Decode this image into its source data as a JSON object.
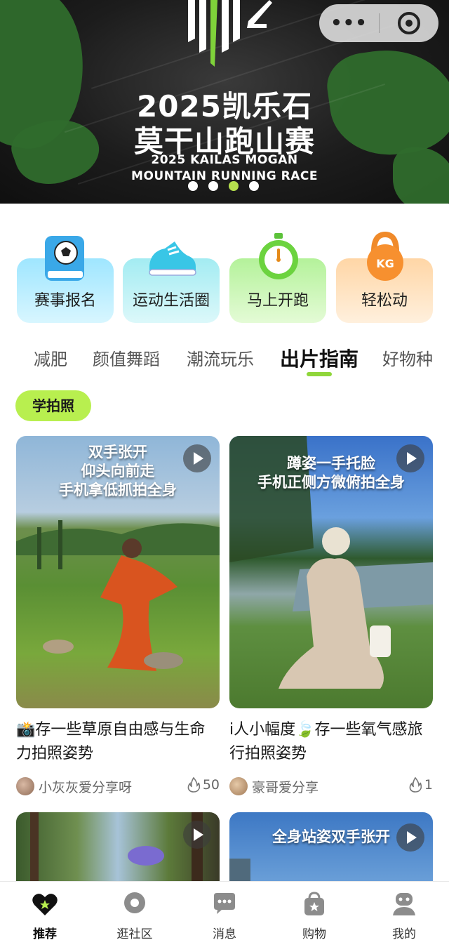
{
  "banner": {
    "title_line1": "2025凯乐石",
    "title_line2": "莫干山跑山赛",
    "subtitle_line1": "2025 KAILAS MOGAN",
    "subtitle_line2": "MOUNTAIN RUNNING RACE",
    "slides": 4,
    "active_slide": 3
  },
  "capsule": {
    "more_label": "•••"
  },
  "quick_tiles": [
    {
      "label": "赛事报名",
      "icon": "soccer-book-icon"
    },
    {
      "label": "运动生活圈",
      "icon": "sneaker-icon"
    },
    {
      "label": "马上开跑",
      "icon": "stopwatch-icon"
    },
    {
      "label": "轻松动",
      "icon": "kettlebell-icon",
      "icon_text": "KG"
    }
  ],
  "categories": [
    {
      "label": "减肥",
      "active": false
    },
    {
      "label": "颜值舞蹈",
      "active": false
    },
    {
      "label": "潮流玩乐",
      "active": false
    },
    {
      "label": "出片指南",
      "active": true
    },
    {
      "label": "好物种",
      "active": false
    }
  ],
  "chip": {
    "label": "学拍照"
  },
  "cards": [
    {
      "overlay": [
        "双手张开",
        "仰头向前走",
        "手机拿低抓拍全身"
      ],
      "title": "📸存一些草原自由感与生命力拍照姿势",
      "author": "小灰灰爱分享呀",
      "likes": "50"
    },
    {
      "overlay": [
        "蹲姿一手托脸",
        "手机正侧方微俯拍全身"
      ],
      "title": "i人小幅度🍃存一些氧气感旅行拍照姿势",
      "author": "豪哥爱分享",
      "likes": "1"
    },
    {
      "overlay": []
    },
    {
      "overlay": [
        "全身站姿双手张开"
      ]
    }
  ],
  "tabbar": [
    {
      "label": "推荐",
      "icon": "heart-star-icon",
      "active": true
    },
    {
      "label": "逛社区",
      "icon": "community-pin-icon",
      "active": false
    },
    {
      "label": "消息",
      "icon": "message-bubble-icon",
      "active": false
    },
    {
      "label": "购物",
      "icon": "shopping-bag-icon",
      "active": false
    },
    {
      "label": "我的",
      "icon": "profile-icon",
      "active": false
    }
  ],
  "colors": {
    "accent_green": "#b8ef4f",
    "indicator_green": "#8fd63a",
    "banner_green": "#2f6b2c"
  }
}
